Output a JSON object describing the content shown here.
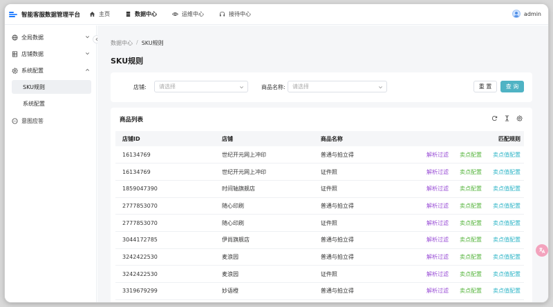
{
  "app": {
    "title": "智能客服数据管理平台"
  },
  "topnav": [
    {
      "label": "主页",
      "icon": "home-icon"
    },
    {
      "label": "数据中心",
      "icon": "database-icon",
      "active": true
    },
    {
      "label": "运维中心",
      "icon": "eye-icon"
    },
    {
      "label": "接待中心",
      "icon": "headset-icon"
    }
  ],
  "user": {
    "name": "admin"
  },
  "sidebar": {
    "items": [
      {
        "label": "全局数据",
        "icon": "globe-icon"
      },
      {
        "label": "店铺数据",
        "icon": "table-icon"
      },
      {
        "label": "系统配置",
        "icon": "settings-icon"
      },
      {
        "label": "SKU规则",
        "sub": true,
        "active": true
      },
      {
        "label": "系统配置",
        "sub": true
      },
      {
        "label": "意图应答",
        "icon": "chat-icon"
      }
    ]
  },
  "breadcrumb": {
    "root": "数据中心",
    "sep": "/",
    "current": "SKU规则"
  },
  "page": {
    "title": "SKU规则"
  },
  "filters": {
    "shop_label": "店铺:",
    "shop_placeholder": "请选择",
    "product_label": "商品名称:",
    "product_placeholder": "请选择",
    "reset": "重 置",
    "query": "查 询"
  },
  "list": {
    "title": "商品列表",
    "columns": [
      "店铺ID",
      "店铺",
      "商品名称",
      "匹配规则"
    ],
    "actions": [
      "解析过滤",
      "卖点配置",
      "卖点值配置"
    ],
    "rows": [
      [
        "16134769",
        "世纪开元网上冲印",
        "普通与拍立得"
      ],
      [
        "16134769",
        "世纪开元网上冲印",
        "证件照"
      ],
      [
        "1859047390",
        "时间轴旗舰店",
        "证件照"
      ],
      [
        "2777853070",
        "随心印刷",
        "普通与拍立得"
      ],
      [
        "2777853070",
        "随心印刷",
        "证件照"
      ],
      [
        "3044172785",
        "伊尚旗舰店",
        "普通与拍立得"
      ],
      [
        "3242422530",
        "麦浪园",
        "普通与拍立得"
      ],
      [
        "3242422530",
        "麦浪园",
        "证件照"
      ],
      [
        "3319679299",
        "妙语橙",
        "普通与拍立得"
      ]
    ]
  },
  "colors": {
    "accent": "#4fb3c4",
    "op_filter": "#9a4fd6",
    "op_selling": "#56b43e",
    "op_value": "#2fb5c7"
  }
}
